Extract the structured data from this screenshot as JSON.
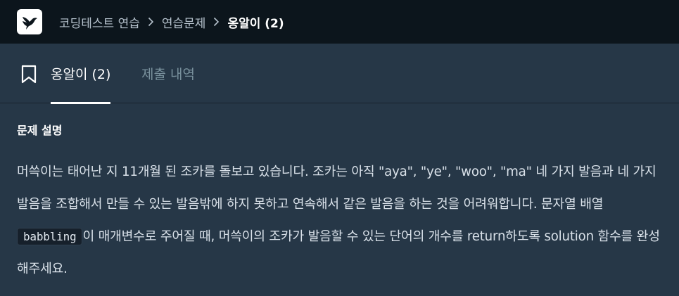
{
  "breadcrumb": {
    "items": [
      "코딩테스트 연습",
      "연습문제"
    ],
    "current": "옹알이 (2)"
  },
  "tabs": {
    "active_label": "옹알이 (2)",
    "submissions_label": "제출 내역"
  },
  "problem": {
    "section_title": "문제 설명",
    "text_before_code": "머쓱이는 태어난 지 11개월 된 조카를 돌보고 있습니다. 조카는 아직 \"aya\", \"ye\", \"woo\", \"ma\" 네 가지 발음과 네 가지 발음을 조합해서 만들 수 있는 발음밖에 하지 못하고 연속해서 같은 발음을 하는 것을 어려워합니다. 문자열 배열 ",
    "code_term": "babbling",
    "text_after_code": "이 매개변수로 주어질 때, 머쓱이의 조카가 발음할 수 있는 단어의 개수를 return하도록 solution 함수를 완성해주세요."
  },
  "icons": {
    "logo": "hummingbird-logo-icon",
    "separator": "chevron-right-icon",
    "bookmark": "bookmark-icon"
  },
  "colors": {
    "topbar_bg": "#0c151c",
    "page_bg": "#263747",
    "inactive_tab": "#78909c"
  }
}
